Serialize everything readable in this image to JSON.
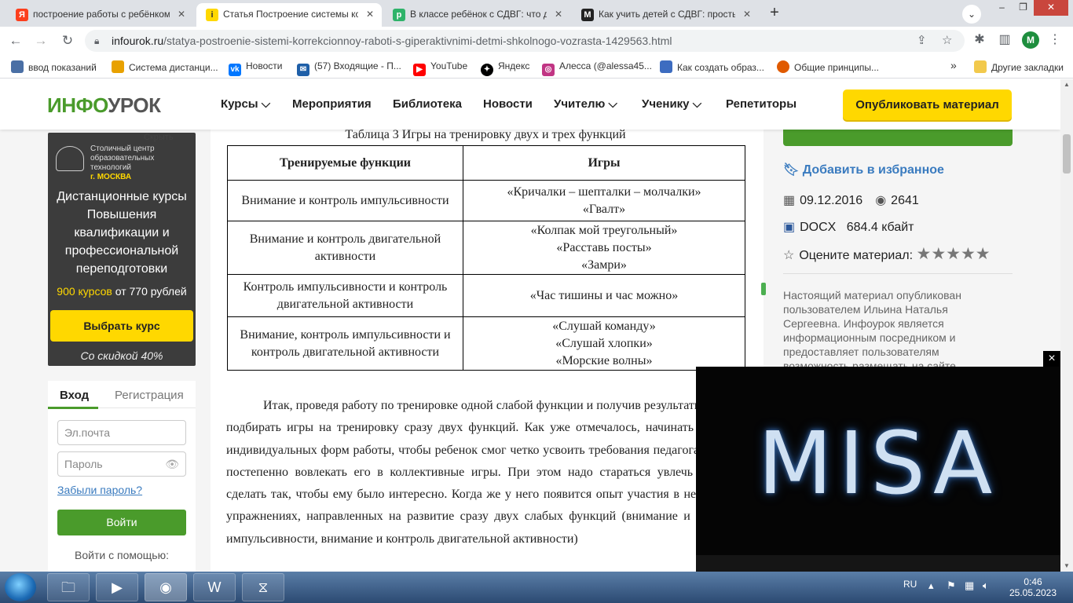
{
  "browser": {
    "tabs": [
      {
        "title": "построение работы с ребёнком",
        "icon_letter": "Я",
        "icon_color": "#fc3f1d"
      },
      {
        "title": "Статья Построение системы кор",
        "icon_letter": "i",
        "icon_color": "#ffd800"
      },
      {
        "title": "В классе ребёнок с СДВГ: что де",
        "icon_letter": "р",
        "icon_color": "#2fb36a"
      },
      {
        "title": "Как учить детей с СДВГ: просты",
        "icon_letter": "M",
        "icon_color": "#222222"
      }
    ],
    "url_host": "infourok.ru",
    "url_path": "/statya-postroenie-sistemi-korrekcionnoy-raboti-s-giperaktivnimi-detmi-shkolnogo-vozrasta-1429563.html",
    "profile_letter": "M",
    "bookmarks": [
      {
        "label": "ввод показаний",
        "icon_color": "#4a6fa5"
      },
      {
        "label": "Система дистанци...",
        "icon_color": "#e8a100"
      },
      {
        "label": "Новости",
        "icon_color": "#0077ff"
      },
      {
        "label": "(57) Входящие - П...",
        "icon_color": "#1f5fa8"
      },
      {
        "label": "YouTube",
        "icon_color": "#ff0000"
      },
      {
        "label": "Яндекс",
        "icon_color": "#000000"
      },
      {
        "label": "Алесса (@alessa45...",
        "icon_color": "#c13584"
      },
      {
        "label": "Как создать образ...",
        "icon_color": "#3d6cc0"
      },
      {
        "label": "Общие принципы...",
        "icon_color": "#e05a00"
      }
    ],
    "bookmarks_more": "»",
    "other_bookmarks": "Другие закладки"
  },
  "site": {
    "logo_part1": "ИНФО",
    "logo_part2": "УРОК",
    "nav": [
      "Курсы",
      "Мероприятия",
      "Библиотека",
      "Новости",
      "Учителю",
      "Ученику",
      "Репетиторы"
    ],
    "publish_button": "Опубликовать материал"
  },
  "ad": {
    "hide": "Скрыть",
    "org_line1": "Столичный центр",
    "org_line2": "образовательных",
    "org_line3": "технологий",
    "org_city": "г. МОСКВА",
    "title": "Дистанционные курсы Повышения квалификации и профессиональной переподготовки",
    "price_highlight": "900 курсов",
    "price_rest": " от 770 рублей",
    "button": "Выбрать курс",
    "discount": "Со скидкой 40%"
  },
  "login": {
    "tab_login": "Вход",
    "tab_register": "Регистрация",
    "email_placeholder": "Эл.почта",
    "password_placeholder": "Пароль",
    "forgot": "Забыли пароль?",
    "button": "Войти",
    "via": "Войти с помощью:"
  },
  "article": {
    "table_caption": "Таблица 3 Игры на тренировку двух и трех функций",
    "headers": [
      "Тренируемые функции",
      "Игры"
    ],
    "rows": [
      {
        "func": "Внимание и контроль импульсивности",
        "games": [
          "«Кричалки – шепталки – молчалки»",
          "«Гвалт»"
        ]
      },
      {
        "func": "Внимание и контроль двигательной активности",
        "games": [
          "«Колпак мой треугольный»",
          "«Расставь посты»",
          "«Замри»"
        ]
      },
      {
        "func": "Контроль импульсивности и контроль двигательной активности",
        "games": [
          "«Час тишины и час можно»"
        ]
      },
      {
        "func": "Внимание, контроль импульсивности и контроль двигательной активности",
        "games": [
          "«Слушай команду»",
          "«Слушай хлопки»",
          "«Морские волны»"
        ]
      }
    ],
    "paragraph": "Итак, проведя работу по тренировке одной слабой функции и получив результаты, можно подбирать игры на тренировку сразу двух функций. Как уже отмечалось, начинать лучше с индивидуальных форм работы, чтобы ребенок смог четко усвоить требования педагога, а затем постепенно вовлекать его в коллективные игры. При этом надо стараться увлечь ребенка, сделать так, чтобы ему было интересно. Когда же у него появится опыт участия в нескольких упражнениях, направленных на развитие сразу двух слабых функций (внимание и контроль импульсивности, внимание и контроль двигательной активности)"
  },
  "sidebar": {
    "favorite": "Добавить в избранное",
    "date": "09.12.2016",
    "views": "2641",
    "file_type": "DOCX",
    "file_size": "684.4 кбайт",
    "rate_label": "Оцените материал:",
    "stars": "★★★★★",
    "info": "Настоящий материал опубликован пользователем Ильина Наталья Сергеевна. Инфоурок является информационным посредником и предоставляет пользователям возможность размещать на сайте"
  },
  "video": {
    "title": "MISA",
    "close": "×"
  },
  "taskbar": {
    "lang": "RU",
    "time": "0:46",
    "date": "25.05.2023"
  },
  "colors": {
    "brand_green": "#4a9b2b",
    "brand_yellow": "#ffd800",
    "link_blue": "#3a7bbf"
  }
}
